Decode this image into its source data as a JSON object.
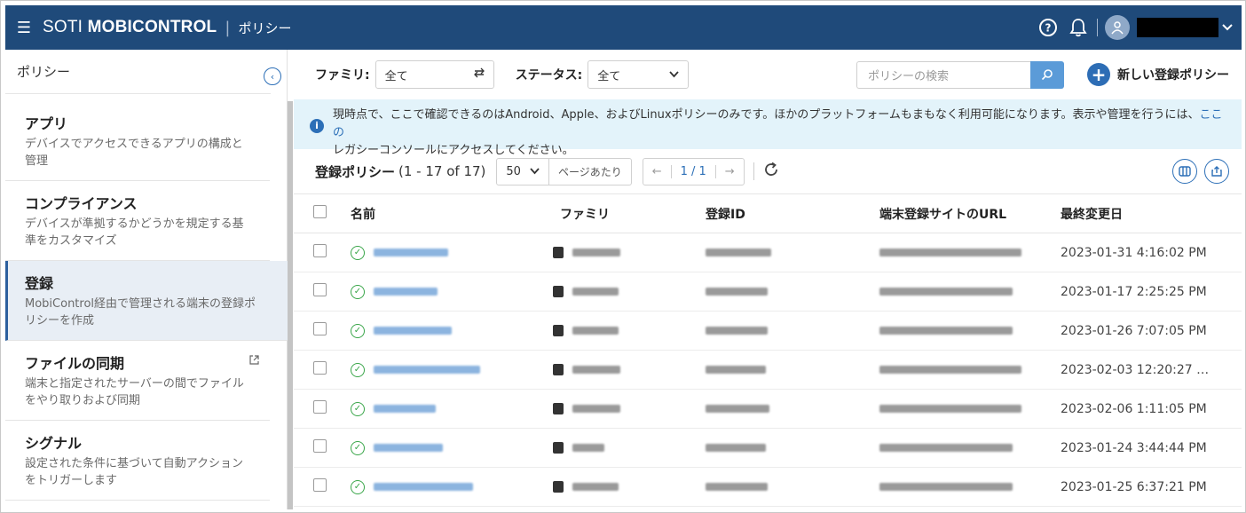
{
  "header": {
    "brand_light": "SOTI ",
    "brand_bold": "MOBICONTROL",
    "separator": "|",
    "breadcrumb": "ポリシー"
  },
  "sidebar": {
    "title": "ポリシー",
    "items": [
      {
        "title": "アプリ",
        "desc": "デバイスでアクセスできるアプリの構成と管理"
      },
      {
        "title": "コンプライアンス",
        "desc": "デバイスが準拠するかどうかを規定する基準をカスタマイズ"
      },
      {
        "title": "登録",
        "desc": "MobiControl経由で管理される端末の登録ポリシーを作成"
      },
      {
        "title": "ファイルの同期",
        "desc": "端末と指定されたサーバーの間でファイルをやり取りおよび同期"
      },
      {
        "title": "シグナル",
        "desc": "設定された条件に基づいて自動アクションをトリガーします"
      }
    ]
  },
  "filters": {
    "family_label": "ファミリ:",
    "family_value": "全て",
    "status_label": "ステータス:",
    "status_value": "全て",
    "search_placeholder": "ポリシーの検索",
    "new_button": "新しい登録ポリシー"
  },
  "notice": {
    "text": "現時点で、ここで確認できるのはAndroid、Apple、およびLinuxポリシーのみです。ほかのプラットフォームもまもなく利用可能になります。表示や管理を行うには、",
    "link": "ここの",
    "text2": "レガシーコンソールにアクセスしてください。"
  },
  "list": {
    "title": "登録ポリシー",
    "range": "(1 - 17 of 17)",
    "per_page_value": "50",
    "per_page_label": "ページあたり",
    "prev": "←",
    "page": "1 / 1",
    "next": "→"
  },
  "table": {
    "headers": [
      "名前",
      "ファミリ",
      "登録ID",
      "端末登録サイトのURL",
      "最終変更日"
    ],
    "rows": [
      {
        "date": "2023-01-31 4:16:02 PM"
      },
      {
        "date": "2023-01-17 2:25:25 PM"
      },
      {
        "date": "2023-01-26 7:07:05 PM"
      },
      {
        "date": "2023-02-03 12:20:27 …"
      },
      {
        "date": "2023-02-06 1:11:05 PM"
      },
      {
        "date": "2023-01-24 3:44:44 PM"
      },
      {
        "date": "2023-01-25 6:37:21 PM"
      }
    ]
  },
  "icons": {
    "menu": "hamburger-icon",
    "help": "help-icon",
    "bell": "bell-icon",
    "user": "user-icon",
    "status": "check-circle-icon"
  },
  "colors": {
    "header_bg": "#1f4a7a",
    "accent": "#2d6db5",
    "notice_bg": "#e3f3fa",
    "active_bg": "#e8eef5",
    "ok": "#3aa64a"
  }
}
